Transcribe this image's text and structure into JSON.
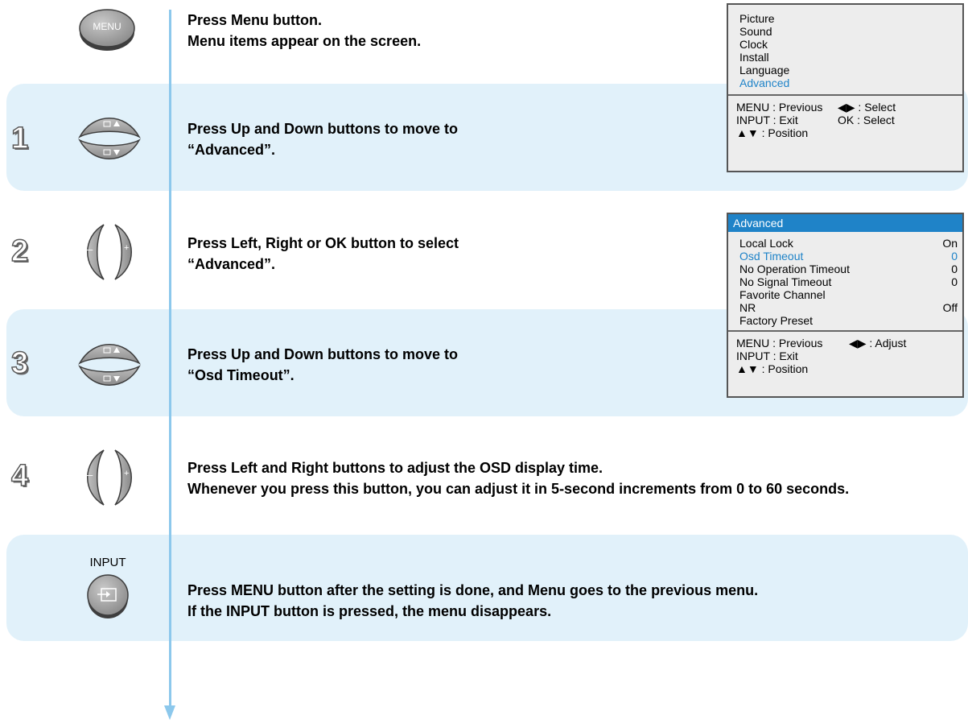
{
  "steps": {
    "intro": {
      "line1": "Press Menu button.",
      "line2": "Menu items appear on the screen."
    },
    "s1": {
      "number": "1",
      "line1": "Press Up and Down buttons to move to",
      "line2": "“Advanced”."
    },
    "s2": {
      "number": "2",
      "line1": "Press Left, Right or OK button to select",
      "line2": "“Advanced”."
    },
    "s3": {
      "number": "3",
      "line1": "Press Up and Down buttons to move to",
      "line2": "“Osd Timeout”."
    },
    "s4": {
      "number": "4",
      "line1": "Press Left and Right buttons to adjust the OSD display time.",
      "line2": "Whenever you press this button, you can adjust it in 5-second increments from 0 to 60 seconds."
    },
    "final": {
      "l1_a": "Press ",
      "l1_b": "MENU",
      "l1_c": " button after the setting is done, and Menu goes to the ",
      "l1_d": "previous menu",
      "l1_e": ".",
      "l2_a": "If the ",
      "l2_b": "INPUT",
      "l2_c": " button is pressed, the ",
      "l2_d": "menu disappears",
      "l2_e": "."
    }
  },
  "buttons": {
    "menu_label": "MENU",
    "input_label": "INPUT",
    "minus": "–",
    "plus": "+",
    "up_arrow": "▲",
    "down_arrow": "▼"
  },
  "osd_main": {
    "items": [
      "Picture",
      "Sound",
      "Clock",
      "Install",
      "Language",
      "Advanced"
    ],
    "highlighted": "Advanced",
    "footer": {
      "r1_left": "MENU : Previous",
      "r1_right": "◀▶ : Select",
      "r2_left": "INPUT : Exit",
      "r2_right": "OK : Select",
      "r3_left": "▲▼ : Position"
    }
  },
  "osd_advanced": {
    "title": "Advanced",
    "rows": [
      {
        "label": "Local Lock",
        "value": "On"
      },
      {
        "label": "Osd Timeout",
        "value": "0"
      },
      {
        "label": "No Operation Timeout",
        "value": "0"
      },
      {
        "label": "No Signal Timeout",
        "value": "0"
      },
      {
        "label": "Favorite Channel",
        "value": ""
      },
      {
        "label": "NR",
        "value": "Off"
      },
      {
        "label": "Factory Preset",
        "value": ""
      }
    ],
    "highlighted": "Osd Timeout",
    "footer": {
      "r1_left": "MENU : Previous",
      "r1_right": "◀▶ : Adjust",
      "r2_left": "INPUT : Exit",
      "r3_left": "▲▼ : Position"
    }
  },
  "colors": {
    "band": "#e1f1fa",
    "line": "#8cc8ec",
    "highlight": "#1f83c8"
  }
}
